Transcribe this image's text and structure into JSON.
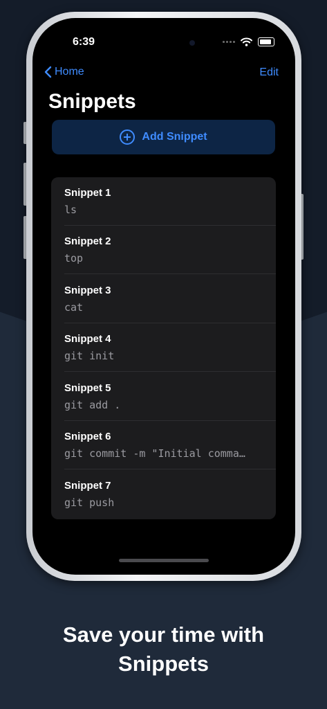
{
  "status_bar": {
    "time": "6:39"
  },
  "nav": {
    "back_label": "Home",
    "edit_label": "Edit"
  },
  "page": {
    "title": "Snippets"
  },
  "add_button": {
    "label": "Add Snippet"
  },
  "snippets": [
    {
      "title": "Snippet 1",
      "command": "ls"
    },
    {
      "title": "Snippet 2",
      "command": "top"
    },
    {
      "title": "Snippet 3",
      "command": "cat"
    },
    {
      "title": "Snippet 4",
      "command": "git init"
    },
    {
      "title": "Snippet 5",
      "command": "git add ."
    },
    {
      "title": "Snippet 6",
      "command": "git commit -m \"Initial comma…"
    },
    {
      "title": "Snippet 7",
      "command": "git push"
    }
  ],
  "caption": {
    "line1": "Save your time with",
    "line2": "Snippets"
  },
  "colors": {
    "accent": "#3f8cff",
    "background": "#1f2a3a",
    "screen": "#000000",
    "list_bg": "#1c1c1e"
  }
}
